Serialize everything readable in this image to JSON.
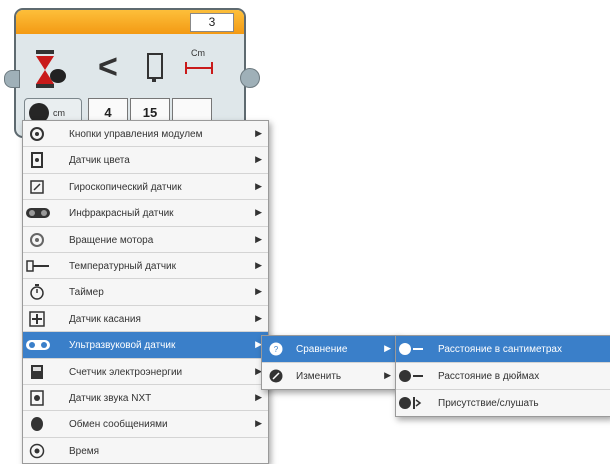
{
  "block": {
    "number": "3",
    "operator": "<",
    "unit_label": "Cm",
    "params": [
      "4",
      "15",
      ""
    ]
  },
  "main_menu": {
    "items": [
      {
        "label": "Кнопки управления модулем",
        "icon": "brick-buttons-icon"
      },
      {
        "label": "Датчик цвета",
        "icon": "color-sensor-icon"
      },
      {
        "label": "Гироскопический датчик",
        "icon": "gyro-sensor-icon"
      },
      {
        "label": "Инфракрасный датчик",
        "icon": "infrared-sensor-icon"
      },
      {
        "label": "Вращение мотора",
        "icon": "motor-rotation-icon"
      },
      {
        "label": "Температурный датчик",
        "icon": "temperature-sensor-icon"
      },
      {
        "label": "Таймер",
        "icon": "timer-icon"
      },
      {
        "label": "Датчик касания",
        "icon": "touch-sensor-icon"
      },
      {
        "label": "Ультразвуковой датчик",
        "icon": "ultrasonic-sensor-icon",
        "active": true
      },
      {
        "label": "Счетчик электроэнергии",
        "icon": "energy-meter-icon"
      },
      {
        "label": "Датчик звука NXT",
        "icon": "sound-sensor-icon"
      },
      {
        "label": "Обмен сообщениями",
        "icon": "messaging-icon"
      },
      {
        "label": "Время",
        "icon": "time-icon"
      }
    ]
  },
  "sub_menu": {
    "items": [
      {
        "label": "Сравнение",
        "icon": "compare-icon",
        "active": true
      },
      {
        "label": "Изменить",
        "icon": "change-icon"
      }
    ]
  },
  "sub_sub_menu": {
    "items": [
      {
        "label": "Расстояние в сантиметрах",
        "icon": "distance-cm-icon",
        "active": true
      },
      {
        "label": "Расстояние в дюймах",
        "icon": "distance-inches-icon"
      },
      {
        "label": "Присутствие/слушать",
        "icon": "presence-icon"
      }
    ]
  },
  "colors": {
    "header_orange": "#f39a14",
    "menu_highlight": "#3a7fc9"
  }
}
